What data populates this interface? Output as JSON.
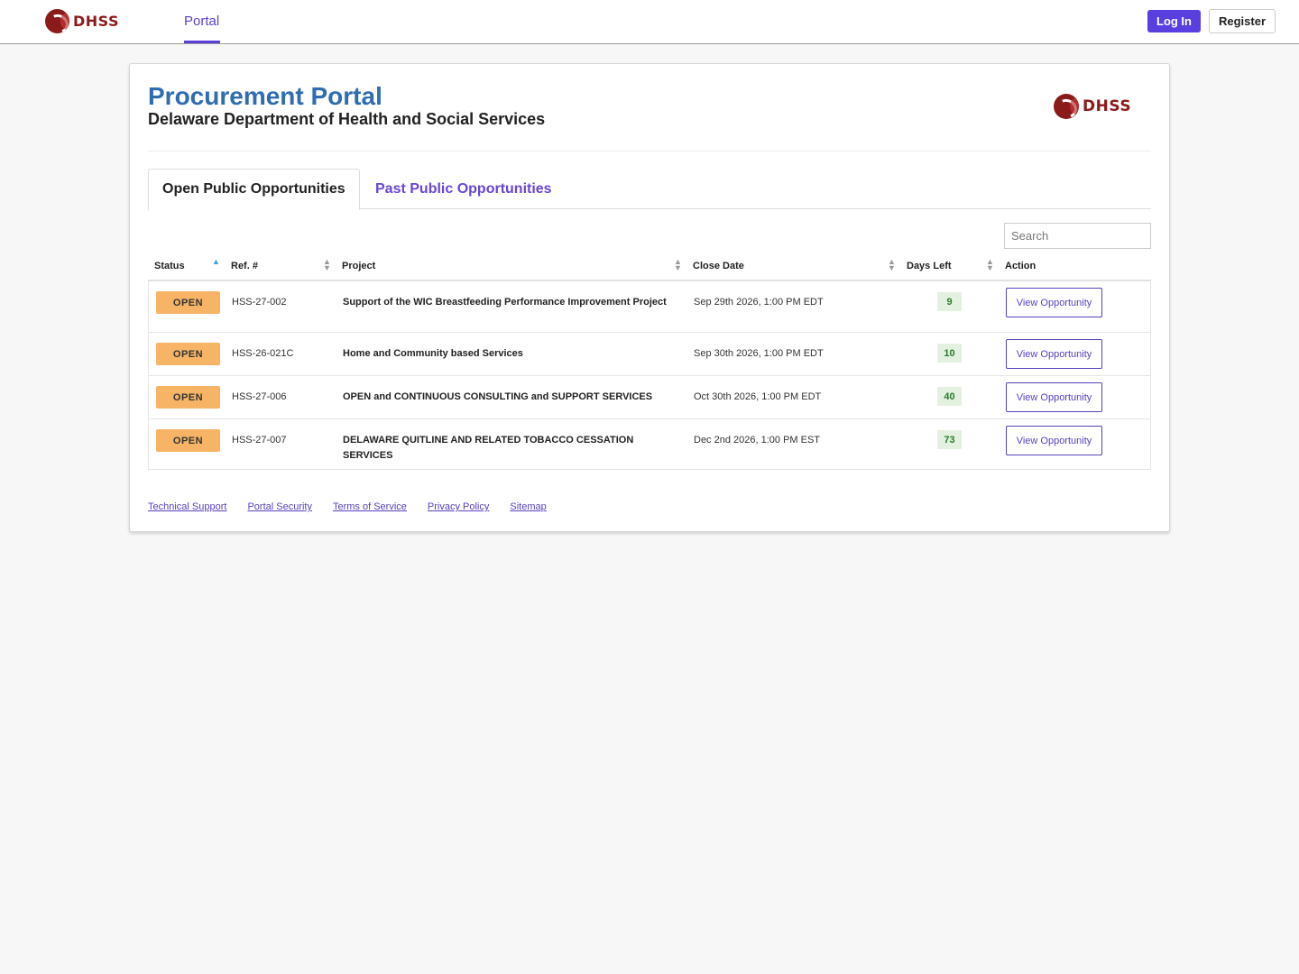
{
  "nav": {
    "logo_text": "DHSS",
    "portal_link": "Portal",
    "login": "Log In",
    "register": "Register"
  },
  "header": {
    "title": "Procurement Portal",
    "subtitle": "Delaware Department of Health and Social Services",
    "logo_text": "DHSS"
  },
  "tabs": [
    {
      "label": "Open Public Opportunities",
      "active": true
    },
    {
      "label": "Past Public Opportunities",
      "active": false
    }
  ],
  "search": {
    "placeholder": "Search"
  },
  "table": {
    "columns": [
      "Status",
      "Ref. #",
      "Project",
      "Close Date",
      "Days Left",
      "Action"
    ],
    "rows": [
      {
        "status": "OPEN",
        "ref": "HSS-27-002",
        "project": "Support of the WIC Breastfeeding Performance Improvement Project",
        "close_date": "Sep 29th 2026, 1:00 PM EDT",
        "days_left": "9",
        "action": "View Opportunity"
      },
      {
        "status": "OPEN",
        "ref": "HSS-26-021C",
        "project": "Home and Community based Services",
        "close_date": "Sep 30th 2026, 1:00 PM EDT",
        "days_left": "10",
        "action": "View Opportunity"
      },
      {
        "status": "OPEN",
        "ref": "HSS-27-006",
        "project": "OPEN and CONTINUOUS CONSULTING and SUPPORT SERVICES",
        "close_date": "Oct 30th 2026, 1:00 PM EDT",
        "days_left": "40",
        "action": "View Opportunity"
      },
      {
        "status": "OPEN",
        "ref": "HSS-27-007",
        "project": "DELAWARE QUITLINE AND RELATED TOBACCO CESSATION SERVICES",
        "close_date": "Dec 2nd 2026, 1:00 PM EST",
        "days_left": "73",
        "action": "View Opportunity"
      }
    ]
  },
  "footer": {
    "links": [
      "Technical Support",
      "Portal Security",
      "Terms of Service",
      "Privacy Policy",
      "Sitemap"
    ]
  },
  "colors": {
    "accent": "#5a3fe0",
    "title_blue": "#2f6db0",
    "open_badge": "#f7b466",
    "days_badge_bg": "#e4f1e0",
    "logo_red": "#8b1a1a"
  },
  "icons": [
    "dhss-logo-icon",
    "sort-icon",
    "sort-asc-icon"
  ]
}
